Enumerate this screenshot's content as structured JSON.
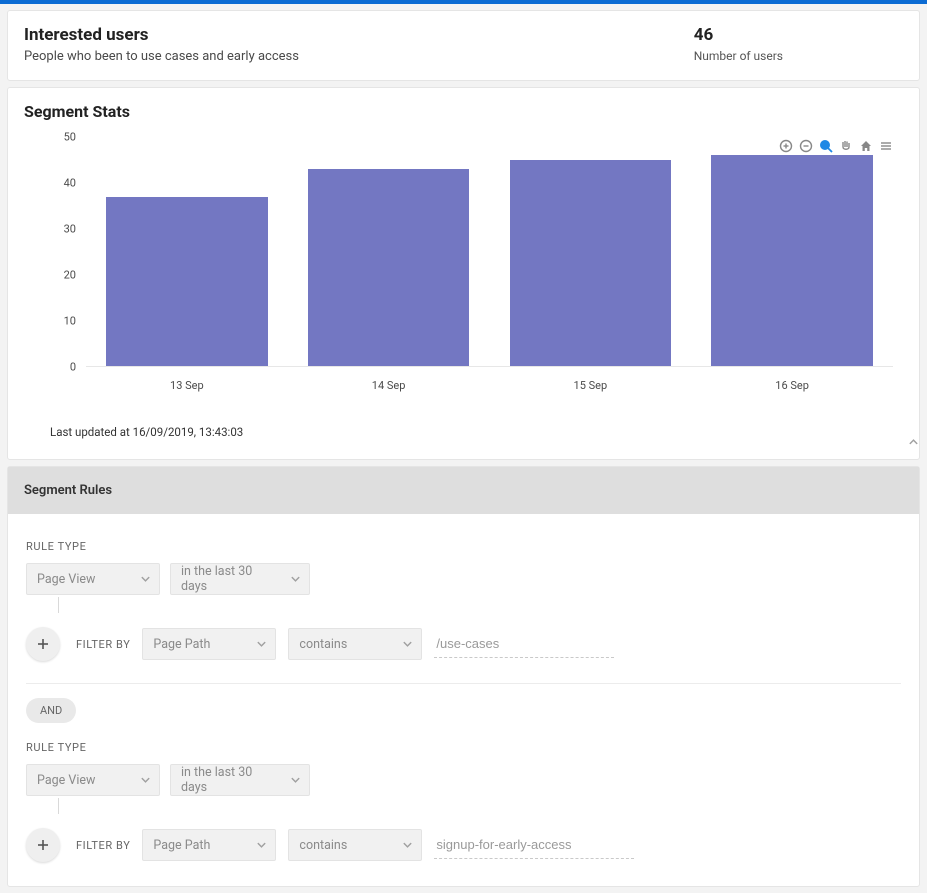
{
  "header": {
    "title": "Interested users",
    "subtitle": "People who been to use cases and early access",
    "count": "46",
    "count_label": "Number of users"
  },
  "stats": {
    "title": "Segment Stats",
    "last_updated": "Last updated at 16/09/2019, 13:43:03"
  },
  "chart_data": {
    "type": "bar",
    "categories": [
      "13 Sep",
      "14 Sep",
      "15 Sep",
      "16 Sep"
    ],
    "values": [
      37,
      43,
      45,
      46
    ],
    "ylim": [
      0,
      50
    ],
    "yticks": [
      0,
      10,
      20,
      30,
      40,
      50
    ],
    "title": "",
    "xlabel": "",
    "ylabel": ""
  },
  "rules": {
    "title": "Segment Rules",
    "labels": {
      "rule_type": "RULE TYPE",
      "filter_by": "FILTER BY",
      "and": "AND"
    },
    "groups": [
      {
        "rule_type": "Page View",
        "timeframe": "in the last 30 days",
        "filter_field": "Page Path",
        "filter_op": "contains",
        "filter_value": "/use-cases"
      },
      {
        "rule_type": "Page View",
        "timeframe": "in the last 30 days",
        "filter_field": "Page Path",
        "filter_op": "contains",
        "filter_value": "signup-for-early-access"
      }
    ]
  }
}
